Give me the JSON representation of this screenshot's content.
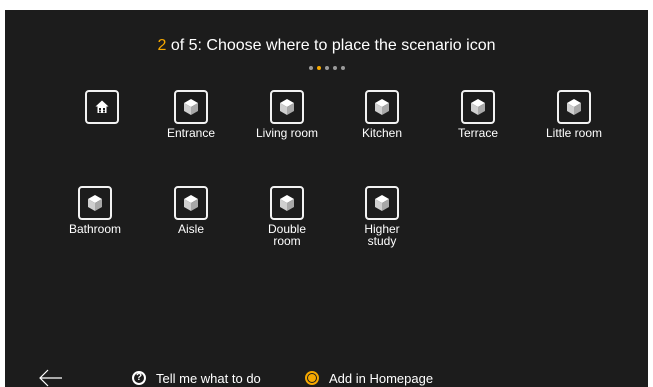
{
  "header": {
    "step_current": "2",
    "step_text": " of 5: Choose where to place the scenario icon",
    "pager": {
      "total": 5,
      "active_index": 1
    }
  },
  "rooms": [
    {
      "icon": "house-icon",
      "label": ""
    },
    {
      "icon": "cube-icon",
      "label": "Entrance"
    },
    {
      "icon": "cube-icon",
      "label": "Living room"
    },
    {
      "icon": "cube-icon",
      "label": "Kitchen"
    },
    {
      "icon": "cube-icon",
      "label": "Terrace"
    },
    {
      "icon": "cube-icon",
      "label": "Little room"
    },
    {
      "icon": "cube-icon",
      "label": "Bathroom"
    },
    {
      "icon": "cube-icon",
      "label": "Aisle"
    },
    {
      "icon": "cube-icon",
      "label": "Double\nroom"
    },
    {
      "icon": "cube-icon",
      "label": "Higher\nstudy"
    }
  ],
  "footer": {
    "back_icon": "arrow-left-icon",
    "help_icon": "question-circle-icon",
    "help_label": "Tell me what to do",
    "homepage_radio_checked": true,
    "homepage_label": "Add in Homepage"
  },
  "colors": {
    "accent": "#f6a800",
    "background": "#1c1c1c",
    "text": "#ffffff"
  }
}
